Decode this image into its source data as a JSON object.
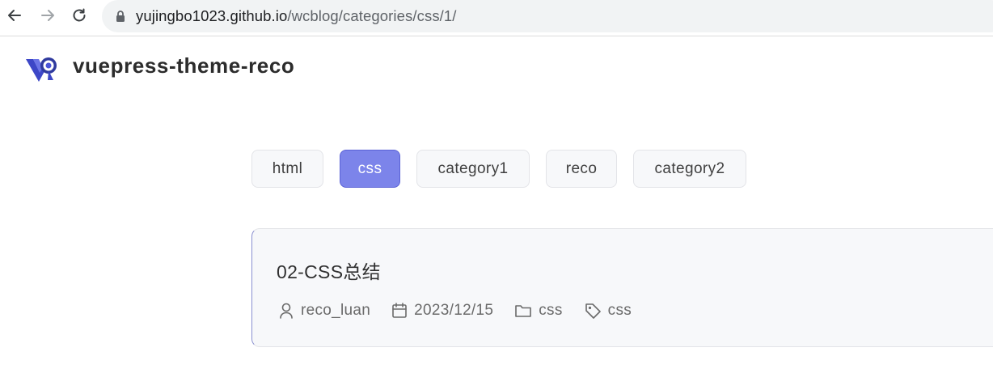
{
  "browser": {
    "url_host": "yujingbo1023.github.io",
    "url_path": "/wcblog/categories/css/1/"
  },
  "site": {
    "title": "vuepress-theme-reco"
  },
  "categories": [
    {
      "label": "html",
      "active": false
    },
    {
      "label": "css",
      "active": true
    },
    {
      "label": "category1",
      "active": false
    },
    {
      "label": "reco",
      "active": false
    },
    {
      "label": "category2",
      "active": false
    }
  ],
  "article": {
    "title": "02-CSS总结",
    "author": "reco_luan",
    "date": "2023/12/15",
    "category": "css",
    "tag": "css"
  },
  "colors": {
    "accent": "#7c84ea",
    "card_bg": "#f7f8fa"
  },
  "icons": [
    "back-arrow-icon",
    "forward-arrow-icon",
    "reload-icon",
    "lock-icon",
    "user-icon",
    "calendar-icon",
    "folder-icon",
    "tag-icon"
  ]
}
